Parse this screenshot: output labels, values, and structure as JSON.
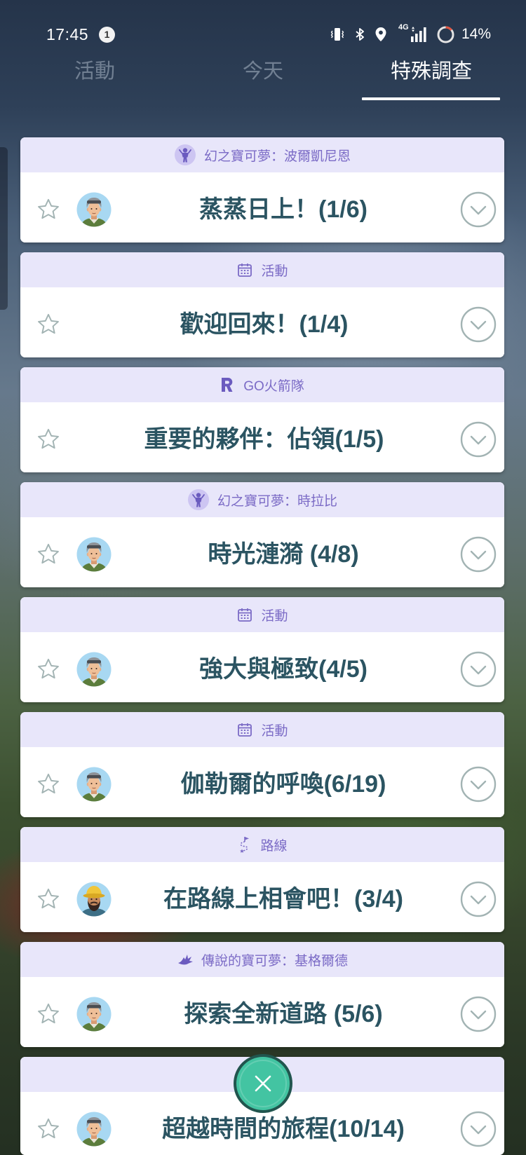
{
  "status_bar": {
    "time": "17:45",
    "notification_count": "1",
    "network": "4G",
    "battery": "14%",
    "battery_level": 0.14
  },
  "tabs": [
    {
      "label": "活動",
      "selected": false
    },
    {
      "label": "今天",
      "selected": false
    },
    {
      "label": "特殊調查",
      "selected": true
    }
  ],
  "research": [
    {
      "category": "幻之寶可夢：波爾凱尼恩",
      "category_icon": "mythical-pokemon-icon",
      "title": "蒸蒸日上！(1/6)",
      "avatar_icon": "willow-avatar-icon",
      "starred": false
    },
    {
      "category": "活動",
      "category_icon": "calendar-icon",
      "title": "歡迎回來！(1/4)",
      "starred": false
    },
    {
      "category": "GO火箭隊",
      "category_icon": "team-go-rocket-icon",
      "title": "重要的夥伴：佔領(1/5)",
      "starred": false
    },
    {
      "category": "幻之寶可夢：時拉比",
      "category_icon": "mythical-pokemon-icon",
      "title": "時光漣漪 (4/8)",
      "avatar_icon": "willow-avatar-icon",
      "starred": false
    },
    {
      "category": "活動",
      "category_icon": "calendar-icon",
      "title": "強大與極致(4/5)",
      "avatar_icon": "willow-avatar-icon",
      "starred": false
    },
    {
      "category": "活動",
      "category_icon": "calendar-icon",
      "title": "伽勒爾的呼喚(6/19)",
      "avatar_icon": "willow-avatar-icon",
      "starred": false
    },
    {
      "category": "路線",
      "category_icon": "route-icon",
      "title": "在路線上相會吧！(3/4)",
      "avatar_icon": "route-guide-avatar-icon",
      "starred": false
    },
    {
      "category": "傳說的寶可夢：基格爾德",
      "category_icon": "legendary-pokemon-icon",
      "title": "探索全新道路 (5/6)",
      "avatar_icon": "willow-avatar-icon",
      "starred": false
    },
    {
      "title": "超越時間的旅程(10/14)",
      "avatar_icon": "willow-avatar-icon",
      "starred": false
    }
  ],
  "close_button": {
    "icon": "close-icon"
  },
  "colors": {
    "header_band": "#e8e6fa",
    "category_text": "#7b6bc6",
    "title_text": "#2b5462",
    "icon_gray": "#a2b3b3",
    "close_button": "#43c4a2"
  }
}
